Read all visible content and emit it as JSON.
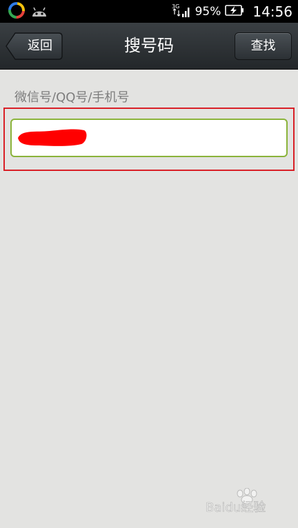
{
  "status_bar": {
    "network": "3G",
    "battery_percent": "95%",
    "time": "14:56",
    "icons": [
      "wandoujia-app-icon",
      "android-robot-icon",
      "signal-icon",
      "battery-charging-icon"
    ]
  },
  "title_bar": {
    "back_label": "返回",
    "title": "搜号码",
    "find_label": "查找"
  },
  "search": {
    "label": "微信号/QQ号/手机号",
    "value": "",
    "value_redacted": true
  },
  "colors": {
    "title_bar": "#2d3236",
    "background": "#e3e3e1",
    "input_border": "#8ab33a",
    "highlight": "#d91f26",
    "redaction": "#ff0000"
  },
  "watermark": {
    "text": "Baidu经验"
  }
}
